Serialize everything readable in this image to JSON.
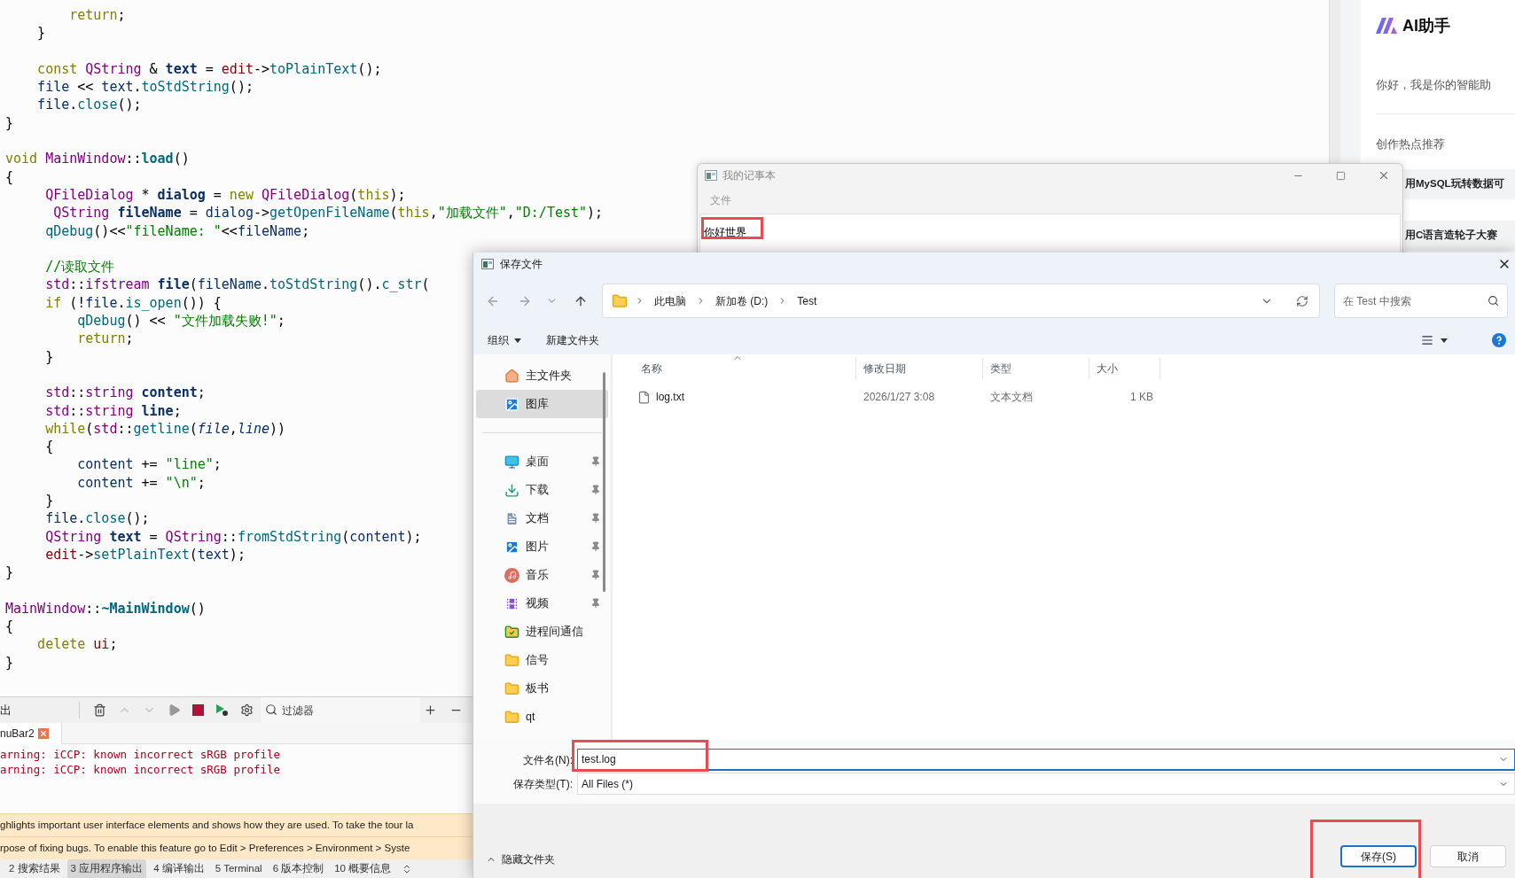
{
  "editor": {
    "lines": [
      {
        "kind": "code",
        "tokens": [
          {
            "kind": "keyword",
            "text": "        return"
          },
          {
            "kind": "plain",
            "text": ";"
          }
        ]
      },
      {
        "kind": "code",
        "tokens": [
          {
            "kind": "plain",
            "text": "    }"
          }
        ]
      },
      {
        "kind": "blank"
      },
      {
        "kind": "code",
        "tokens": [
          {
            "kind": "keyword",
            "text": "    const "
          },
          {
            "kind": "type",
            "text": "QString"
          },
          {
            "kind": "plain",
            "text": " & "
          },
          {
            "kind": "local_decl",
            "text": "text"
          },
          {
            "kind": "plain",
            "text": " = "
          },
          {
            "kind": "member",
            "text": "edit"
          },
          {
            "kind": "plain",
            "text": "->"
          },
          {
            "kind": "function",
            "text": "toPlainText"
          },
          {
            "kind": "plain",
            "text": "();"
          }
        ]
      },
      {
        "kind": "code",
        "tokens": [
          {
            "kind": "local",
            "text": "    file"
          },
          {
            "kind": "plain",
            "text": " << "
          },
          {
            "kind": "local",
            "text": "text"
          },
          {
            "kind": "plain",
            "text": "."
          },
          {
            "kind": "function",
            "text": "toStdString"
          },
          {
            "kind": "plain",
            "text": "();"
          }
        ]
      },
      {
        "kind": "code",
        "tokens": [
          {
            "kind": "local",
            "text": "    file"
          },
          {
            "kind": "plain",
            "text": "."
          },
          {
            "kind": "function",
            "text": "close"
          },
          {
            "kind": "plain",
            "text": "();"
          }
        ]
      },
      {
        "kind": "code",
        "tokens": [
          {
            "kind": "plain",
            "text": "}"
          }
        ]
      },
      {
        "kind": "blank"
      },
      {
        "kind": "code",
        "tokens": [
          {
            "kind": "keyword",
            "text": "void "
          },
          {
            "kind": "type",
            "text": "MainWindow"
          },
          {
            "kind": "plain",
            "text": "::"
          },
          {
            "kind": "function_decl",
            "text": "load"
          },
          {
            "kind": "plain",
            "text": "()"
          }
        ]
      },
      {
        "kind": "code",
        "tokens": [
          {
            "kind": "plain",
            "text": "{"
          }
        ]
      },
      {
        "kind": "code",
        "tokens": [
          {
            "kind": "type",
            "text": "     QFileDialog"
          },
          {
            "kind": "plain",
            "text": " * "
          },
          {
            "kind": "local_decl",
            "text": "dialog"
          },
          {
            "kind": "plain",
            "text": " = "
          },
          {
            "kind": "keyword",
            "text": "new "
          },
          {
            "kind": "type",
            "text": "QFileDialog"
          },
          {
            "kind": "plain",
            "text": "("
          },
          {
            "kind": "keyword",
            "text": "this"
          },
          {
            "kind": "plain",
            "text": ");"
          }
        ]
      },
      {
        "kind": "code",
        "tokens": [
          {
            "kind": "type",
            "text": "      QString "
          },
          {
            "kind": "local_decl",
            "text": "fileName"
          },
          {
            "kind": "plain",
            "text": " = "
          },
          {
            "kind": "local",
            "text": "dialog"
          },
          {
            "kind": "plain",
            "text": "->"
          },
          {
            "kind": "function",
            "text": "getOpenFileName"
          },
          {
            "kind": "plain",
            "text": "("
          },
          {
            "kind": "keyword",
            "text": "this"
          },
          {
            "kind": "plain",
            "text": ","
          },
          {
            "kind": "string",
            "text": "\"加载文件\""
          },
          {
            "kind": "plain",
            "text": ","
          },
          {
            "kind": "string",
            "text": "\"D:/Test\""
          },
          {
            "kind": "plain",
            "text": ");"
          }
        ]
      },
      {
        "kind": "code",
        "tokens": [
          {
            "kind": "function",
            "text": "     qDebug"
          },
          {
            "kind": "plain",
            "text": "()<<"
          },
          {
            "kind": "string",
            "text": "\"fileName: \""
          },
          {
            "kind": "plain",
            "text": "<<"
          },
          {
            "kind": "local",
            "text": "fileName"
          },
          {
            "kind": "plain",
            "text": ";"
          }
        ]
      },
      {
        "kind": "blank"
      },
      {
        "kind": "code",
        "tokens": [
          {
            "kind": "comment",
            "text": "     //读取文件"
          }
        ]
      },
      {
        "kind": "code",
        "tokens": [
          {
            "kind": "type",
            "text": "     std"
          },
          {
            "kind": "plain",
            "text": "::"
          },
          {
            "kind": "type",
            "text": "ifstream "
          },
          {
            "kind": "local_decl",
            "text": "file"
          },
          {
            "kind": "plain",
            "text": "("
          },
          {
            "kind": "local",
            "text": "fileName"
          },
          {
            "kind": "plain",
            "text": "."
          },
          {
            "kind": "function",
            "text": "toStdString"
          },
          {
            "kind": "plain",
            "text": "()."
          },
          {
            "kind": "function",
            "text": "c_str"
          },
          {
            "kind": "plain",
            "text": "("
          }
        ]
      },
      {
        "kind": "code",
        "tokens": [
          {
            "kind": "keyword",
            "text": "     if"
          },
          {
            "kind": "plain",
            "text": " (!"
          },
          {
            "kind": "local",
            "text": "file"
          },
          {
            "kind": "plain",
            "text": "."
          },
          {
            "kind": "function",
            "text": "is_open"
          },
          {
            "kind": "plain",
            "text": "()) {"
          }
        ]
      },
      {
        "kind": "code",
        "tokens": [
          {
            "kind": "function",
            "text": "         qDebug"
          },
          {
            "kind": "plain",
            "text": "() << "
          },
          {
            "kind": "string",
            "text": "\"文件加载失败!\""
          },
          {
            "kind": "plain",
            "text": ";"
          }
        ]
      },
      {
        "kind": "code",
        "tokens": [
          {
            "kind": "keyword",
            "text": "         return"
          },
          {
            "kind": "plain",
            "text": ";"
          }
        ]
      },
      {
        "kind": "code",
        "tokens": [
          {
            "kind": "plain",
            "text": "     }"
          }
        ]
      },
      {
        "kind": "blank"
      },
      {
        "kind": "code",
        "tokens": [
          {
            "kind": "type",
            "text": "     std"
          },
          {
            "kind": "plain",
            "text": "::"
          },
          {
            "kind": "type",
            "text": "string "
          },
          {
            "kind": "local_decl",
            "text": "content"
          },
          {
            "kind": "plain",
            "text": ";"
          }
        ]
      },
      {
        "kind": "code",
        "tokens": [
          {
            "kind": "type",
            "text": "     std"
          },
          {
            "kind": "plain",
            "text": "::"
          },
          {
            "kind": "type",
            "text": "string "
          },
          {
            "kind": "local_decl",
            "text": "line"
          },
          {
            "kind": "plain",
            "text": ";"
          }
        ]
      },
      {
        "kind": "code",
        "tokens": [
          {
            "kind": "keyword",
            "text": "     while"
          },
          {
            "kind": "plain",
            "text": "("
          },
          {
            "kind": "type",
            "text": "std"
          },
          {
            "kind": "plain",
            "text": "::"
          },
          {
            "kind": "function",
            "text": "getline"
          },
          {
            "kind": "plain",
            "text": "("
          },
          {
            "kind": "parameter",
            "text": "file"
          },
          {
            "kind": "plain",
            "text": ","
          },
          {
            "kind": "parameter",
            "text": "line"
          },
          {
            "kind": "plain",
            "text": "))"
          }
        ]
      },
      {
        "kind": "code",
        "tokens": [
          {
            "kind": "plain",
            "text": "     {"
          }
        ]
      },
      {
        "kind": "code",
        "tokens": [
          {
            "kind": "local",
            "text": "         content"
          },
          {
            "kind": "plain",
            "text": " += "
          },
          {
            "kind": "string",
            "text": "\"line\""
          },
          {
            "kind": "plain",
            "text": ";"
          }
        ]
      },
      {
        "kind": "code",
        "tokens": [
          {
            "kind": "local",
            "text": "         content"
          },
          {
            "kind": "plain",
            "text": " += "
          },
          {
            "kind": "string",
            "text": "\"\\n\""
          },
          {
            "kind": "plain",
            "text": ";"
          }
        ]
      },
      {
        "kind": "code",
        "tokens": [
          {
            "kind": "plain",
            "text": "     }"
          }
        ]
      },
      {
        "kind": "code",
        "tokens": [
          {
            "kind": "local",
            "text": "     file"
          },
          {
            "kind": "plain",
            "text": "."
          },
          {
            "kind": "function",
            "text": "close"
          },
          {
            "kind": "plain",
            "text": "();"
          }
        ]
      },
      {
        "kind": "code",
        "tokens": [
          {
            "kind": "type",
            "text": "     QString "
          },
          {
            "kind": "local_decl",
            "text": "text"
          },
          {
            "kind": "plain",
            "text": " = "
          },
          {
            "kind": "type",
            "text": "QString"
          },
          {
            "kind": "plain",
            "text": "::"
          },
          {
            "kind": "function",
            "text": "fromStdString"
          },
          {
            "kind": "plain",
            "text": "("
          },
          {
            "kind": "local",
            "text": "content"
          },
          {
            "kind": "plain",
            "text": ");"
          }
        ]
      },
      {
        "kind": "code",
        "tokens": [
          {
            "kind": "member",
            "text": "     edit"
          },
          {
            "kind": "plain",
            "text": "->"
          },
          {
            "kind": "function",
            "text": "setPlainText"
          },
          {
            "kind": "plain",
            "text": "("
          },
          {
            "kind": "local",
            "text": "text"
          },
          {
            "kind": "plain",
            "text": ");"
          }
        ]
      },
      {
        "kind": "code",
        "tokens": [
          {
            "kind": "plain",
            "text": "}"
          }
        ]
      },
      {
        "kind": "blank"
      },
      {
        "kind": "code",
        "tokens": [
          {
            "kind": "type",
            "text": "MainWindow"
          },
          {
            "kind": "plain",
            "text": "::"
          },
          {
            "kind": "function_decl",
            "text": "~MainWindow"
          },
          {
            "kind": "plain",
            "text": "()"
          }
        ]
      },
      {
        "kind": "code",
        "tokens": [
          {
            "kind": "plain",
            "text": "{"
          }
        ]
      },
      {
        "kind": "code",
        "tokens": [
          {
            "kind": "keyword",
            "text": "    delete "
          },
          {
            "kind": "member",
            "text": "ui"
          },
          {
            "kind": "plain",
            "text": ";"
          }
        ]
      },
      {
        "kind": "code",
        "tokens": [
          {
            "kind": "plain",
            "text": "}"
          }
        ]
      }
    ]
  },
  "output_panel": {
    "title": "出",
    "filter_placeholder": "过滤器",
    "tabs": [
      {
        "label": "nuBar2",
        "selected": true
      }
    ],
    "lines": [
      "arning: iCCP: known incorrect sRGB profile",
      "arning: iCCP: known incorrect sRGB profile"
    ],
    "notices": [
      "ghlights important user interface elements and shows how they are used. To take the tour la",
      "rpose of fixing bugs. To enable this feature go to Edit > Preferences > Environment > Syste"
    ]
  },
  "bottom_tabs": [
    {
      "label": "2 搜索结果",
      "selected": false
    },
    {
      "label": "3 应用程序输出",
      "selected": true
    },
    {
      "label": "4 编译输出",
      "selected": false
    },
    {
      "label": "5 Terminal",
      "selected": false
    },
    {
      "label": "6 版本控制",
      "selected": false
    },
    {
      "label": "10 概要信息",
      "selected": false
    }
  ],
  "ai_panel": {
    "title": "AI助手",
    "greeting": "你好，我是你的智能助",
    "section": "创作热点推荐",
    "topics": [
      "用MySQL玩转数据可",
      "用C语言造轮子大赛"
    ]
  },
  "notepad": {
    "title": "我的记事本",
    "menu": [
      "文件"
    ],
    "text": "你好世界",
    "annotated": true
  },
  "save_dialog": {
    "title": "保存文件",
    "breadcrumb": [
      "此电脑",
      "新加卷 (D:)",
      "Test"
    ],
    "search_placeholder": "在 Test 中搜索",
    "commands": [
      {
        "label": "组织",
        "menu": true
      },
      {
        "label": "新建文件夹",
        "menu": false
      }
    ],
    "nav_groups": [
      {
        "items": [
          {
            "label": "主文件夹",
            "kind": "home",
            "pinned": false,
            "selected": false
          },
          {
            "label": "图库",
            "kind": "gallery",
            "pinned": false,
            "selected": true
          }
        ]
      },
      {
        "items": [
          {
            "label": "桌面",
            "kind": "desktop",
            "pinned": true,
            "selected": false
          },
          {
            "label": "下载",
            "kind": "downloads",
            "pinned": true,
            "selected": false
          },
          {
            "label": "文档",
            "kind": "documents",
            "pinned": true,
            "selected": false
          },
          {
            "label": "图片",
            "kind": "pictures",
            "pinned": true,
            "selected": false
          },
          {
            "label": "音乐",
            "kind": "music",
            "pinned": true,
            "selected": false
          },
          {
            "label": "视频",
            "kind": "videos",
            "pinned": true,
            "selected": false
          },
          {
            "label": "进程间通信",
            "kind": "synced_folder",
            "pinned": false,
            "selected": false
          },
          {
            "label": "信号",
            "kind": "folder",
            "pinned": false,
            "selected": false
          },
          {
            "label": "板书",
            "kind": "folder",
            "pinned": false,
            "selected": false
          },
          {
            "label": "qt",
            "kind": "folder",
            "pinned": false,
            "selected": false
          }
        ]
      }
    ],
    "columns": [
      {
        "label": "名称",
        "sorted": true
      },
      {
        "label": "修改日期",
        "sorted": false
      },
      {
        "label": "类型",
        "sorted": false
      },
      {
        "label": "大小",
        "sorted": false
      }
    ],
    "files": [
      {
        "name": "log.txt",
        "modified": "2026/1/27 3:08",
        "type": "文本文档",
        "size": "1 KB",
        "selected": false
      }
    ],
    "fields": [
      {
        "label": "文件名(N):",
        "value": "test.log",
        "focused": true,
        "annotated": true
      },
      {
        "label": "保存类型(T):",
        "value": "All Files (*)",
        "focused": false,
        "annotated": false
      }
    ],
    "hide_folders": "隐藏文件夹",
    "buttons": [
      {
        "label": "保存(S)",
        "primary": true,
        "annotated": true
      },
      {
        "label": "取消",
        "primary": false,
        "annotated": false
      }
    ]
  }
}
